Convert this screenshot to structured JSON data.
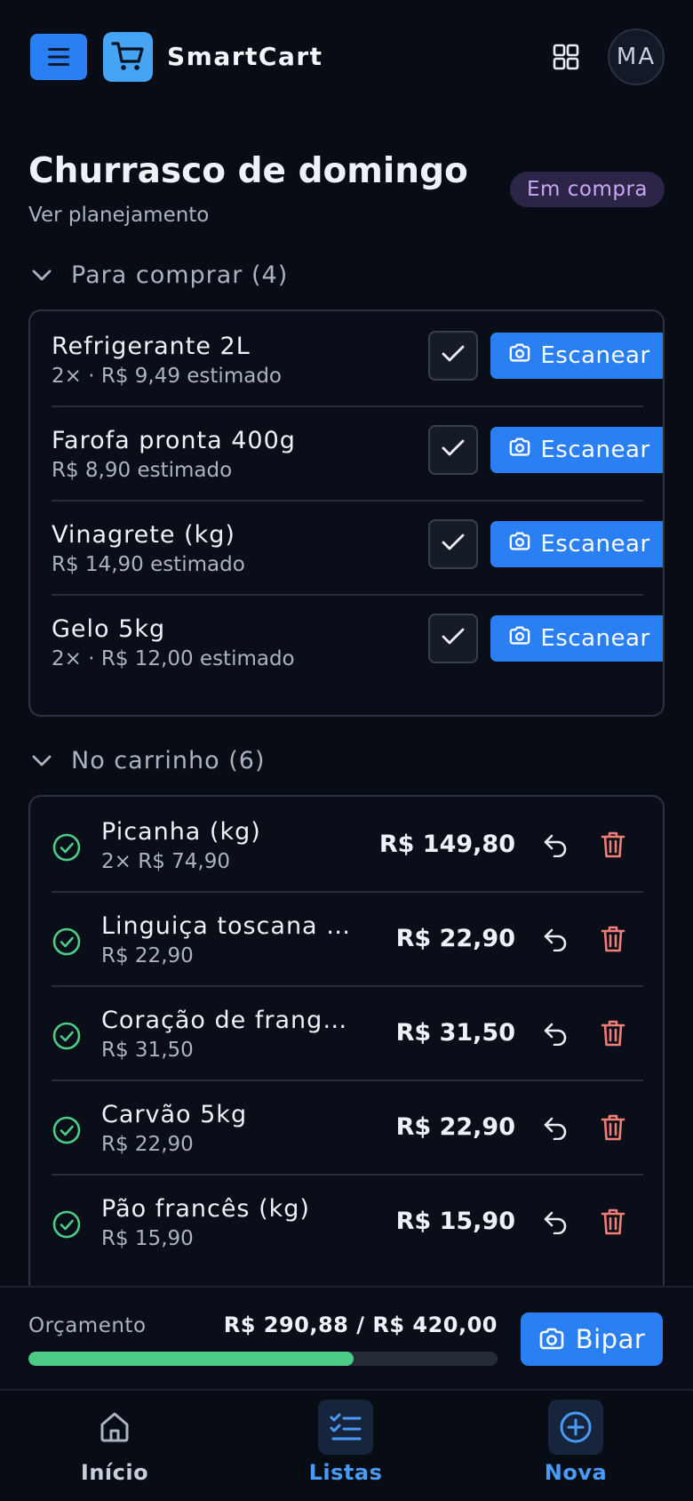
{
  "header": {
    "app_name": "SmartCart",
    "avatar_initials": "MA"
  },
  "list": {
    "title": "Churrasco de domingo",
    "plan_link": "Ver planejamento",
    "status": "Em compra"
  },
  "to_buy": {
    "heading": "Para comprar (4)",
    "scan_label": "Escanear",
    "items": [
      {
        "name": "Refrigerante 2L",
        "meta": "2× · R$ 9,49 estimado"
      },
      {
        "name": "Farofa pronta 400g",
        "meta": "R$ 8,90 estimado"
      },
      {
        "name": "Vinagrete (kg)",
        "meta": "R$ 14,90 estimado"
      },
      {
        "name": "Gelo 5kg",
        "meta": "2× · R$ 12,00 estimado"
      }
    ]
  },
  "in_cart": {
    "heading": "No carrinho (6)",
    "items": [
      {
        "name": "Picanha (kg)",
        "meta": "2× R$ 74,90",
        "total": "R$ 149,80"
      },
      {
        "name": "Linguiça toscana …",
        "meta": "R$ 22,90",
        "total": "R$ 22,90"
      },
      {
        "name": "Coração de frang…",
        "meta": "R$ 31,50",
        "total": "R$ 31,50"
      },
      {
        "name": "Carvão 5kg",
        "meta": "R$ 22,90",
        "total": "R$ 22,90"
      },
      {
        "name": "Pão francês (kg)",
        "meta": "R$ 15,90",
        "total": "R$ 15,90"
      }
    ]
  },
  "budget": {
    "label": "Orçamento",
    "value": "R$ 290,88 / R$ 420,00",
    "progress": 0.6926,
    "scan_button": "Bipar"
  },
  "nav": {
    "items": [
      {
        "label": "Início",
        "icon": "home-icon",
        "active": false
      },
      {
        "label": "Listas",
        "icon": "list-check-icon",
        "active": true
      },
      {
        "label": "Nova",
        "icon": "plus-circle-icon",
        "active": false
      }
    ]
  },
  "colors": {
    "background": "#080c15",
    "accent": "#2a7ff2",
    "success": "#4ccc84",
    "danger": "#f07f78",
    "badge_bg": "#2d2548",
    "badge_text": "#c8a8f5"
  }
}
